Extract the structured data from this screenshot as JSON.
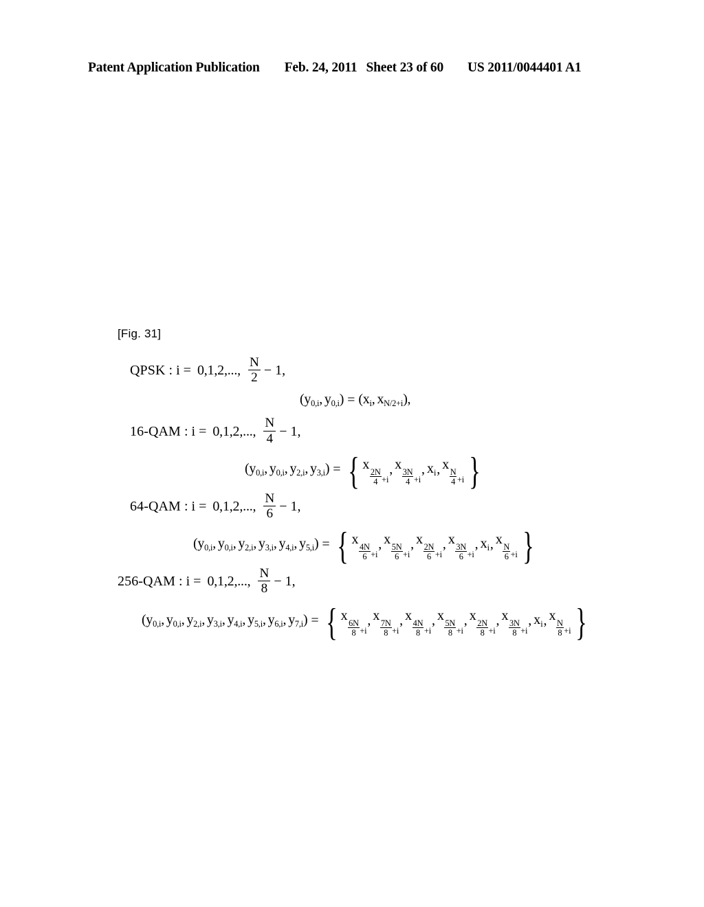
{
  "header": {
    "publication": "Patent Application Publication",
    "date": "Feb. 24, 2011",
    "sheet": "Sheet 23 of 60",
    "document_number": "US 2011/0044401 A1"
  },
  "figure": {
    "label": "[Fig. 31]"
  },
  "equations": {
    "qpsk": {
      "modulation": "QPSK",
      "separator": ":",
      "index_var": "i",
      "equals": "=",
      "index_values": "0,1,2,...,",
      "limit_numerator": "N",
      "limit_denominator": "2",
      "limit_offset": "− 1,",
      "lhs_open": "(",
      "lhs_terms": [
        "y",
        "y"
      ],
      "lhs_subscripts": [
        "0,i",
        "0,i"
      ],
      "lhs_close": ")",
      "map_equals": "=",
      "rhs_open": "(",
      "rhs_terms": [
        "x",
        "x"
      ],
      "rhs_subscripts": [
        "i",
        "N/2+i"
      ],
      "rhs_close": "),"
    },
    "qam16": {
      "modulation": "16-QAM",
      "separator": ":",
      "index_var": "i",
      "equals": "=",
      "index_values": "0,1,2,...,",
      "limit_numerator": "N",
      "limit_denominator": "4",
      "limit_offset": "− 1,",
      "lhs_open": "(",
      "lhs_terms": [
        "y",
        "y",
        "y",
        "y"
      ],
      "lhs_subscripts": [
        "0,i",
        "0,i",
        "2,i",
        "3,i"
      ],
      "lhs_close": ")",
      "map_equals": "=",
      "brace_open": "{",
      "brace_close": "}",
      "rhs_items": [
        {
          "base": "x",
          "num": "2N",
          "den": "4",
          "offset": "+i"
        },
        {
          "base": "x",
          "num": "3N",
          "den": "4",
          "offset": "+i"
        },
        {
          "base": "x",
          "plain_sub": "i"
        },
        {
          "base": "x",
          "num": "N",
          "den": "4",
          "offset": "+i"
        }
      ]
    },
    "qam64": {
      "modulation": "64-QAM",
      "separator": ":",
      "index_var": "i",
      "equals": "=",
      "index_values": "0,1,2,...,",
      "limit_numerator": "N",
      "limit_denominator": "6",
      "limit_offset": "− 1,",
      "lhs_open": "(",
      "lhs_terms": [
        "y",
        "y",
        "y",
        "y",
        "y",
        "y"
      ],
      "lhs_subscripts": [
        "0,i",
        "0,i",
        "2,i",
        "3,i",
        "4,i",
        "5,i"
      ],
      "lhs_close": ")",
      "map_equals": "=",
      "brace_open": "{",
      "brace_close": "}",
      "rhs_items": [
        {
          "base": "x",
          "num": "4N",
          "den": "6",
          "offset": "+i"
        },
        {
          "base": "x",
          "num": "5N",
          "den": "6",
          "offset": "+i"
        },
        {
          "base": "x",
          "num": "2N",
          "den": "6",
          "offset": "+i"
        },
        {
          "base": "x",
          "num": "3N",
          "den": "6",
          "offset": "+i"
        },
        {
          "base": "x",
          "plain_sub": "i"
        },
        {
          "base": "x",
          "num": "N",
          "den": "6",
          "offset": "+i"
        }
      ]
    },
    "qam256": {
      "modulation": "256-QAM",
      "separator": ":",
      "index_var": "i",
      "equals": "=",
      "index_values": "0,1,2,...,",
      "limit_numerator": "N",
      "limit_denominator": "8",
      "limit_offset": "− 1,",
      "lhs_open": "(",
      "lhs_terms": [
        "y",
        "y",
        "y",
        "y",
        "y",
        "y",
        "y",
        "y"
      ],
      "lhs_subscripts": [
        "0,i",
        "0,i",
        "2,i",
        "3,i",
        "4,i",
        "5,i",
        "6,i",
        "7,i"
      ],
      "lhs_close": ")",
      "map_equals": "=",
      "brace_open": "{",
      "brace_close": "}",
      "rhs_items": [
        {
          "base": "x",
          "num": "6N",
          "den": "8",
          "offset": "+i"
        },
        {
          "base": "x",
          "num": "7N",
          "den": "8",
          "offset": "+i"
        },
        {
          "base": "x",
          "num": "4N",
          "den": "8",
          "offset": "+i"
        },
        {
          "base": "x",
          "num": "5N",
          "den": "8",
          "offset": "+i"
        },
        {
          "base": "x",
          "num": "2N",
          "den": "8",
          "offset": "+i"
        },
        {
          "base": "x",
          "num": "3N",
          "den": "8",
          "offset": "+i"
        },
        {
          "base": "x",
          "plain_sub": "i"
        },
        {
          "base": "x",
          "num": "N",
          "den": "8",
          "offset": "+i"
        }
      ]
    }
  },
  "punctuation": {
    "comma": ",",
    "open_paren": "(",
    "close_paren": ")"
  }
}
